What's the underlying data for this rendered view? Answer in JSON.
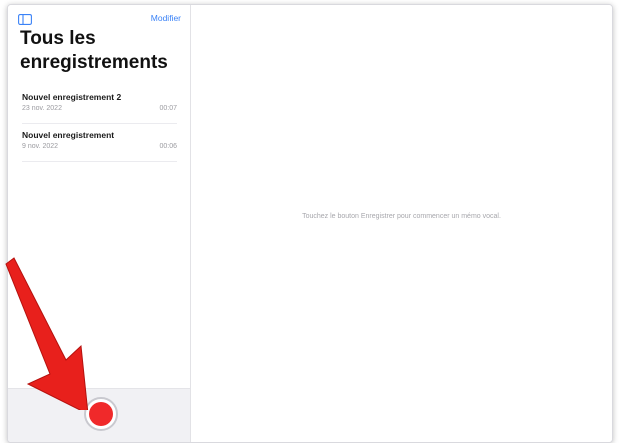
{
  "sidebar": {
    "toggle_icon": "sidebar-toggle-icon",
    "edit_label": "Modifier",
    "title_line1": "Tous les",
    "title_line2": "enregistrements",
    "recordings": [
      {
        "name": "Nouvel enregistrement 2",
        "date": "23 nov. 2022",
        "duration": "00:07"
      },
      {
        "name": "Nouvel enregistrement",
        "date": "9 nov. 2022",
        "duration": "00:06"
      }
    ]
  },
  "main": {
    "empty_message": "Touchez le bouton Enregistrer pour commencer un mémo vocal."
  },
  "record_button": {
    "icon": "record-icon"
  },
  "annotation": {
    "icon": "red-arrow-icon",
    "color": "#e8201c"
  },
  "colors": {
    "accent": "#3a82f7",
    "record": "#f0292a"
  }
}
